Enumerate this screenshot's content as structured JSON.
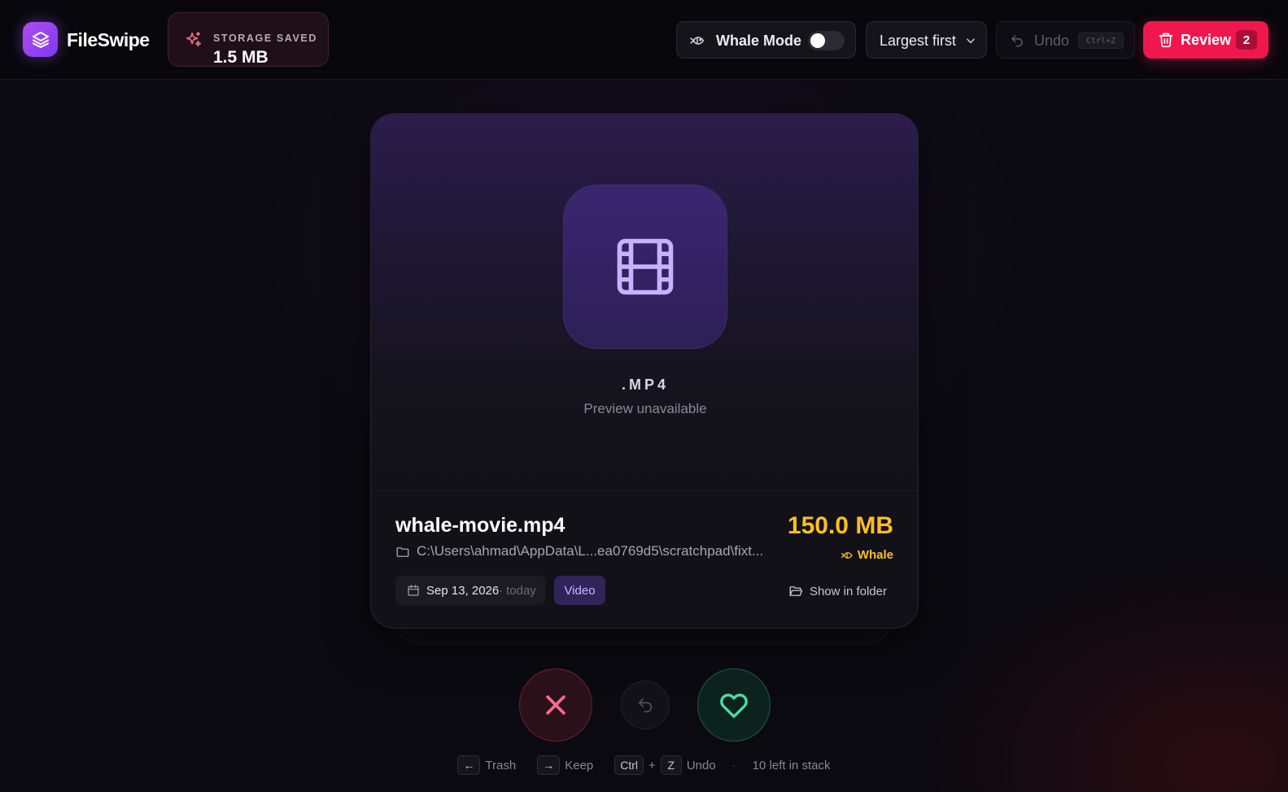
{
  "app": {
    "name": "FileSwipe",
    "accent": "#a855f7"
  },
  "stats": {
    "label": "STORAGE SAVED",
    "value": "1.5 MB"
  },
  "toolbar": {
    "whale_mode_label": "Whale Mode",
    "whale_mode_on": false,
    "sort_label": "Largest first",
    "undo_label": "Undo",
    "undo_shortcut": "Ctrl+Z",
    "review_label": "Review",
    "review_count": "2",
    "review_color": "#f0174f"
  },
  "card": {
    "extension": ".MP4",
    "preview_note": "Preview unavailable",
    "file_name": "whale-movie.mp4",
    "path": "C:\\Users\\ahmad\\AppData\\L...ea0769d5\\scratchpad\\fixt...",
    "size": "150.0 MB",
    "size_color": "#fbbf24",
    "size_tag": "Whale",
    "date": "Sep 13, 2026",
    "date_relative": "· today",
    "type": "Video",
    "show_in_folder": "Show in folder",
    "icon": "film-icon"
  },
  "actions": {
    "trash_icon": "x-icon",
    "undo_icon": "undo-icon",
    "keep_icon": "heart-icon"
  },
  "hints": {
    "trash_key": "←",
    "trash_label": "Trash",
    "keep_key": "→",
    "keep_label": "Keep",
    "ctrl_key": "Ctrl",
    "plus": "+",
    "z_key": "Z",
    "undo_label": "Undo",
    "separator": "·",
    "remaining": "10 left in stack"
  }
}
